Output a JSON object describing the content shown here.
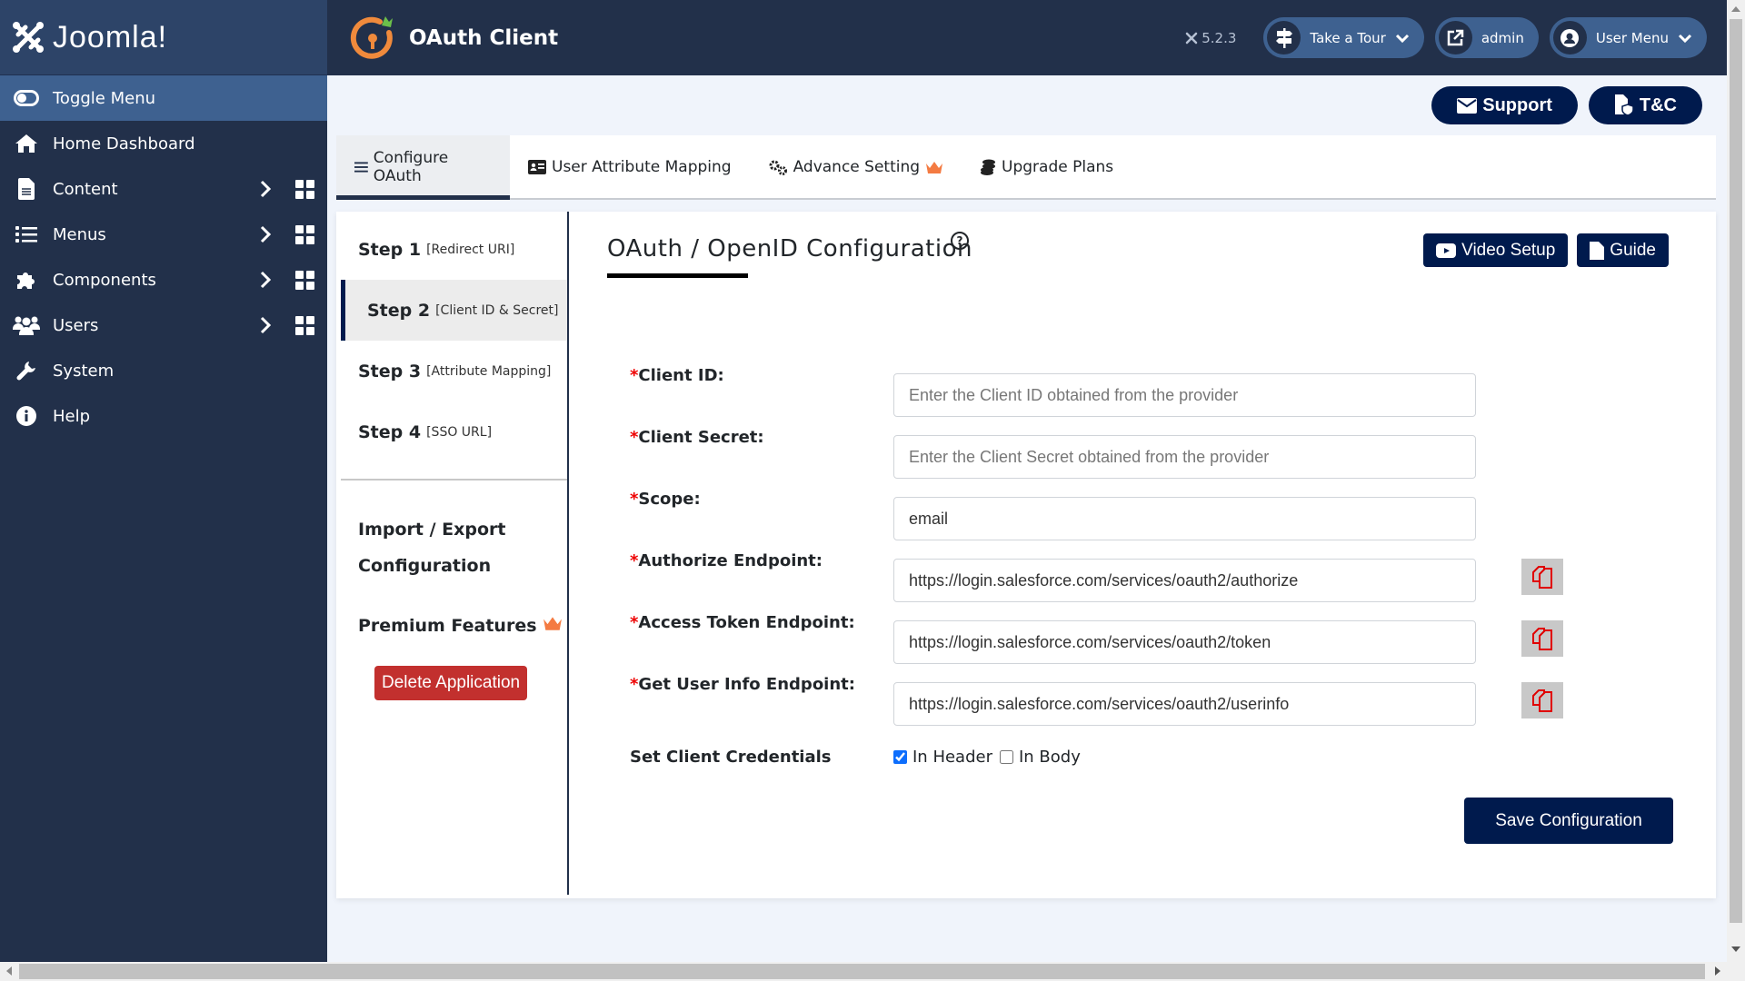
{
  "brand": {
    "name": "Joomla!",
    "version": "5.2.3"
  },
  "header": {
    "app_title": "OAuth Client",
    "take_tour": "Take a Tour",
    "admin": "admin",
    "user_menu": "User Menu"
  },
  "sidebar": {
    "toggle": "Toggle Menu",
    "items": [
      {
        "label": "Home Dashboard",
        "icon": "home-icon"
      },
      {
        "label": "Content",
        "icon": "file-icon",
        "has_submenu": true
      },
      {
        "label": "Menus",
        "icon": "list-icon",
        "has_submenu": true
      },
      {
        "label": "Components",
        "icon": "puzzle-icon",
        "has_submenu": true
      },
      {
        "label": "Users",
        "icon": "users-icon",
        "has_submenu": true
      },
      {
        "label": "System",
        "icon": "wrench-icon"
      },
      {
        "label": "Help",
        "icon": "info-icon"
      }
    ]
  },
  "top_buttons": {
    "support": "Support",
    "tc": "T&C"
  },
  "tabs": [
    {
      "label": "Configure OAuth",
      "active": true
    },
    {
      "label": "User Attribute Mapping"
    },
    {
      "label": "Advance Setting",
      "premium": true
    },
    {
      "label": "Upgrade Plans"
    }
  ],
  "steps": [
    {
      "title": "Step 1",
      "sub": "[Redirect URI]"
    },
    {
      "title": "Step 2",
      "sub": "[Client ID & Secret]",
      "active": true
    },
    {
      "title": "Step 3",
      "sub": "[Attribute Mapping]"
    },
    {
      "title": "Step 4",
      "sub": "[SSO URL]"
    }
  ],
  "side_links": {
    "import_export_1": "Import / Export",
    "import_export_2": "Configuration",
    "premium": "Premium Features",
    "delete": "Delete Application"
  },
  "form": {
    "title": "OAuth / OpenID Configuration",
    "video_setup": "Video Setup",
    "guide": "Guide",
    "required_mark": "*",
    "fields": [
      {
        "label": "Client ID:",
        "value": "",
        "placeholder": "Enter the Client ID obtained from the provider"
      },
      {
        "label": "Client Secret:",
        "value": "",
        "placeholder": "Enter the Client Secret obtained from the provider"
      },
      {
        "label": "Scope:",
        "value": "email",
        "placeholder": ""
      },
      {
        "label": "Authorize Endpoint:",
        "value": "https://login.salesforce.com/services/oauth2/authorize",
        "copy": true
      },
      {
        "label": "Access Token Endpoint:",
        "value": "https://login.salesforce.com/services/oauth2/token",
        "copy": true
      },
      {
        "label": "Get User Info Endpoint:",
        "value": "https://login.salesforce.com/services/oauth2/userinfo",
        "copy": true
      }
    ],
    "credentials": {
      "label": "Set Client Credentials",
      "in_header": "In Header",
      "in_header_checked": true,
      "in_body": "In Body",
      "in_body_checked": false
    },
    "save": "Save Configuration"
  },
  "colors": {
    "sidebar_bg": "#22304a",
    "accent_navy": "#001a4d",
    "toggle_bg": "#3e6190",
    "delete_red": "#c2302e",
    "crown_orange": "#f47b42",
    "copy_icon_red": "#e00000"
  }
}
